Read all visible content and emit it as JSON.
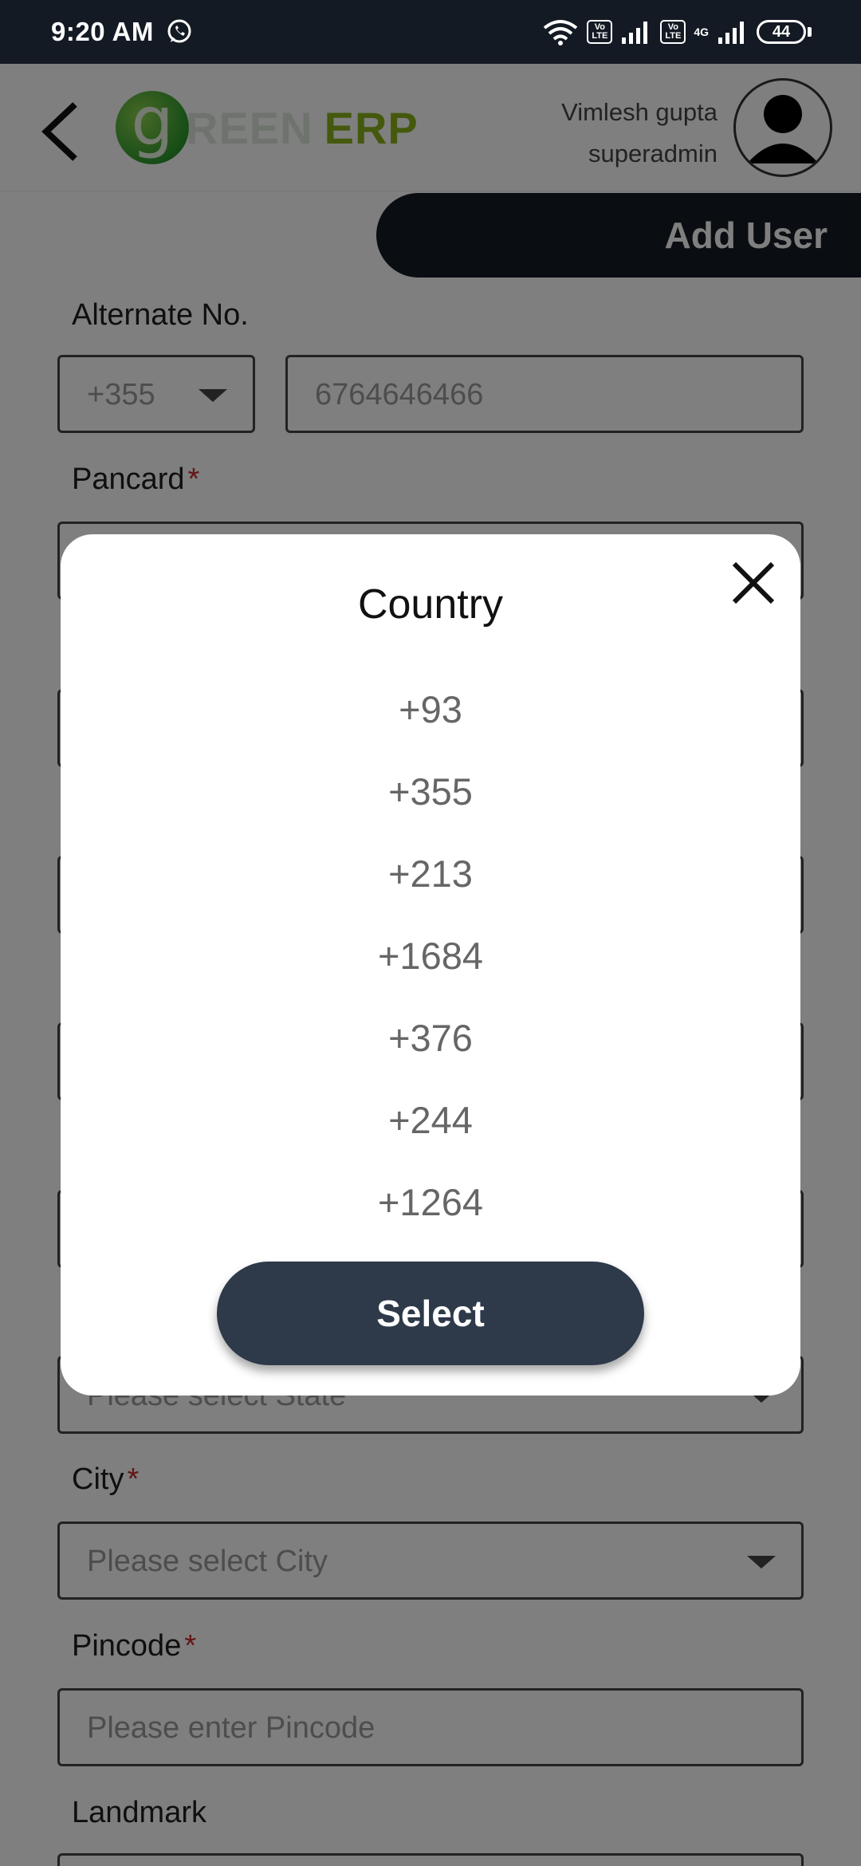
{
  "status_bar": {
    "time": "9:20 AM",
    "lte1": "Vo LTE",
    "lte2": "Vo LTE",
    "network": "4G",
    "battery": "44"
  },
  "header": {
    "logo": {
      "g": "g",
      "reen": "REEN",
      "erp": "ERP"
    },
    "user_name": "Vimlesh gupta",
    "user_role": "superadmin"
  },
  "banner": {
    "title": "Add User"
  },
  "form": {
    "alternate_label": "Alternate No.",
    "alternate_code": "+355",
    "alternate_number": "6764646466",
    "pancard_label": "Pancard",
    "state_placeholder": "Please select State",
    "city_label": "City",
    "city_placeholder": "Please select City",
    "pincode_label": "Pincode",
    "pincode_placeholder": "Please enter Pincode",
    "landmark_label": "Landmark",
    "required_mark": "*"
  },
  "modal": {
    "title": "Country",
    "options": [
      "+93",
      "+355",
      "+213",
      "+1684",
      "+376",
      "+244",
      "+1264"
    ],
    "select_label": "Select"
  },
  "icons": {
    "back": "back-arrow-icon",
    "close": "close-icon",
    "avatar": "user-avatar-icon",
    "caret": "chevron-down-icon",
    "whatsapp": "whatsapp-icon",
    "wifi": "wifi-icon",
    "signal": "signal-icon",
    "battery": "battery-icon"
  }
}
